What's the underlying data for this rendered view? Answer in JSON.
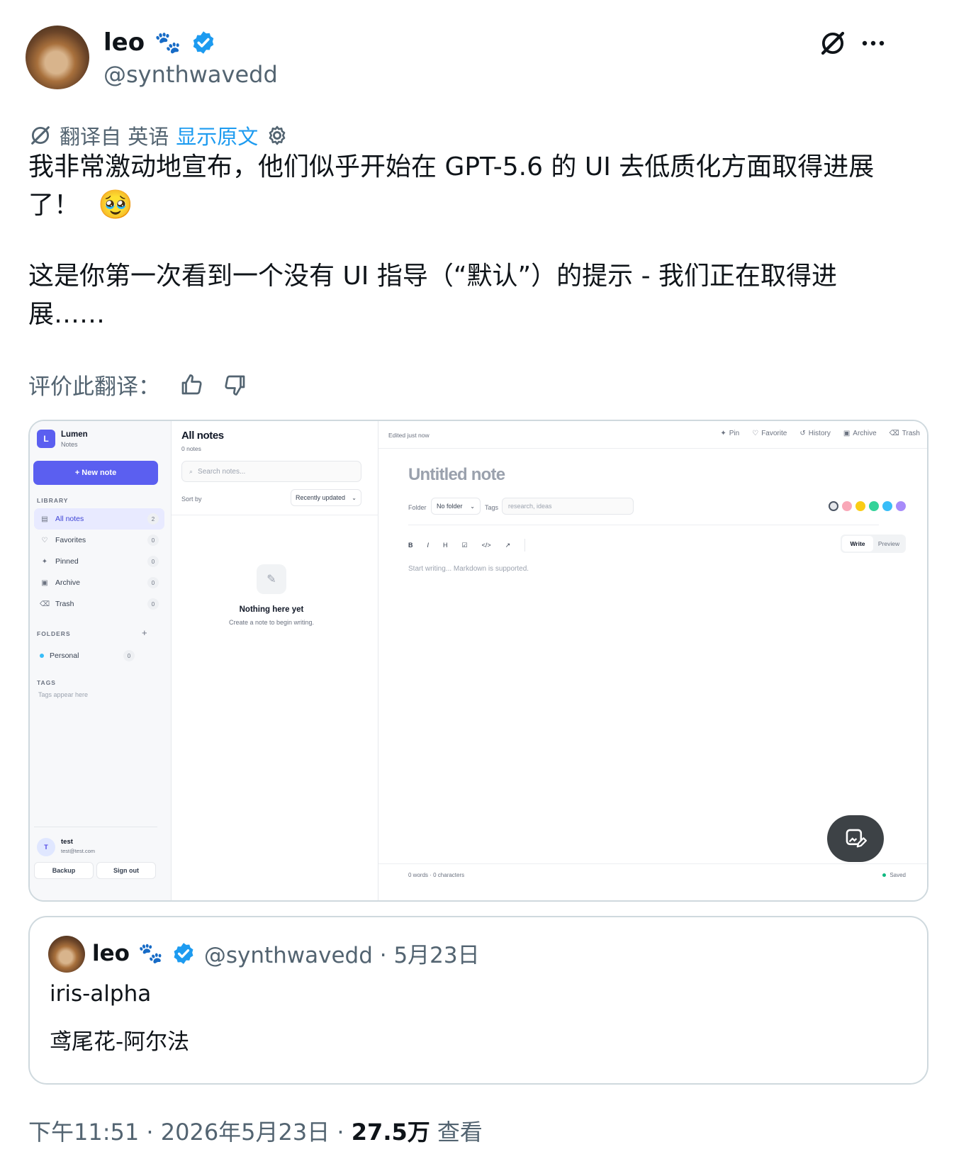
{
  "tweet": {
    "author_name": "leo",
    "author_emoji": "🐾",
    "author_handle": "@synthwavedd",
    "translation_bar": {
      "label": "翻译自 英语",
      "show_original": "显示原文"
    },
    "text_line1": "我非常激动地宣布，他们似乎开始在 GPT-5.6 的 UI 去低质化方面取得进展",
    "text_line2": "了！",
    "text_emoji": "🥹",
    "text_line3": "这是你第一次看到一个没有 UI 指导（“默认”）的提示 - 我们正在取得进",
    "text_line4": "展……",
    "rate_label": "评价此翻译：",
    "footer": {
      "time": "下午11:51 · 2026年5月23日 · ",
      "views": "27.5万",
      "views_label": " 查看"
    }
  },
  "quote": {
    "author_name": "leo",
    "author_emoji": "🐾",
    "meta": "@synthwavedd · 5月23日",
    "line1": "iris-alpha",
    "line2": "鸢尾花-阿尔法"
  },
  "app": {
    "brand": {
      "logo_letter": "L",
      "name": "Lumen",
      "sub": "Notes"
    },
    "new_note": "+ New note",
    "library_label": "LIBRARY",
    "library": [
      {
        "label": "All notes",
        "count": "2",
        "icon": "▤"
      },
      {
        "label": "Favorites",
        "count": "0",
        "icon": "♡"
      },
      {
        "label": "Pinned",
        "count": "0",
        "icon": "✦"
      },
      {
        "label": "Archive",
        "count": "0",
        "icon": "▣"
      },
      {
        "label": "Trash",
        "count": "0",
        "icon": "⌫"
      }
    ],
    "folders_label": "FOLDERS",
    "folders_add": "+",
    "folders": [
      {
        "label": "Personal",
        "count": "0",
        "color": "#38bdf8"
      }
    ],
    "tags_label": "TAGS",
    "tags_empty": "Tags appear here",
    "user": {
      "initial": "T",
      "name": "test",
      "email": "test@test.com"
    },
    "backup": "Backup",
    "sign_out": "Sign out",
    "list": {
      "title": "All notes",
      "count": "0 notes",
      "search_placeholder": "Search notes...",
      "sort_label": "Sort by",
      "sort_value": "Recently updated",
      "empty_title": "Nothing here yet",
      "empty_sub": "Create a note to begin writing."
    },
    "editor": {
      "status": "Edited just now",
      "actions": [
        {
          "icon": "✦",
          "label": "Pin"
        },
        {
          "icon": "♡",
          "label": "Favorite"
        },
        {
          "icon": "↺",
          "label": "History"
        },
        {
          "icon": "▣",
          "label": "Archive"
        },
        {
          "icon": "⌫",
          "label": "Trash"
        }
      ],
      "title_placeholder": "Untitled note",
      "folder_label": "Folder",
      "folder_value": "No folder",
      "tags_label": "Tags",
      "tags_placeholder": "research, ideas",
      "colors": [
        "#e5e7eb",
        "#f9a8b8",
        "#facc15",
        "#34d399",
        "#38bdf8",
        "#a78bfa"
      ],
      "format_buttons": [
        "B",
        "I",
        "H",
        "☑",
        "</>",
        "↗"
      ],
      "write_tab": "Write",
      "preview_tab": "Preview",
      "body_placeholder": "Start writing... Markdown is supported.",
      "counts": "0 words · 0 characters",
      "saved": "Saved"
    }
  }
}
